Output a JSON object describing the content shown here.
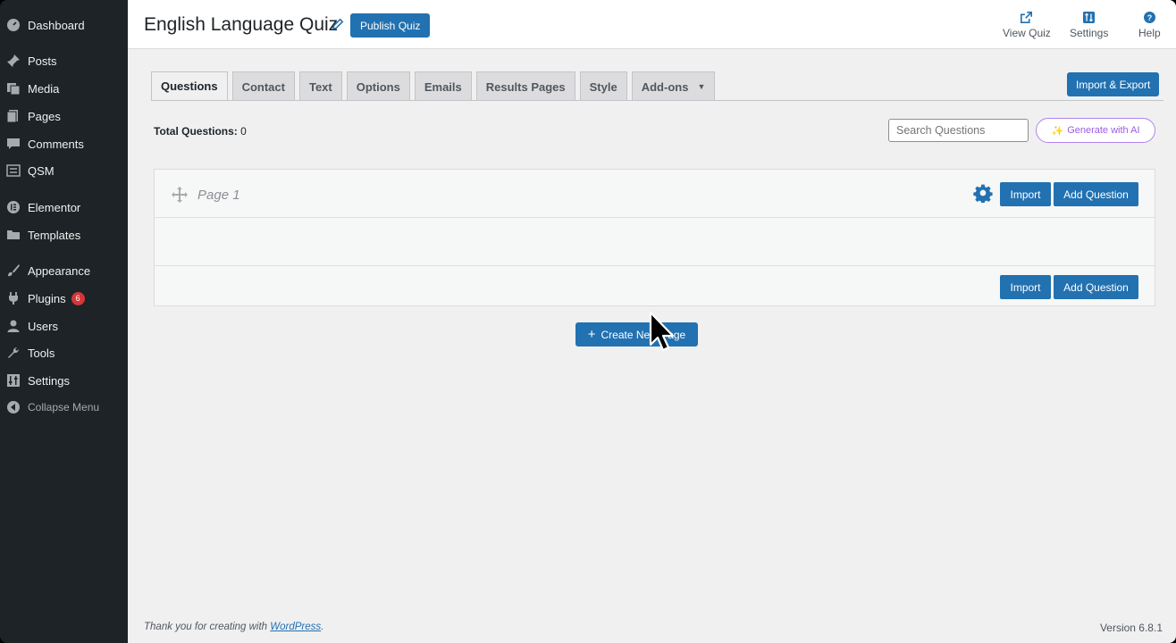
{
  "sidebar": {
    "items": [
      {
        "label": "Dashboard",
        "icon": "dashboard-icon"
      },
      {
        "label": "Posts",
        "icon": "pin-icon"
      },
      {
        "label": "Media",
        "icon": "media-icon"
      },
      {
        "label": "Pages",
        "icon": "pages-icon"
      },
      {
        "label": "Comments",
        "icon": "comment-icon"
      },
      {
        "label": "QSM",
        "icon": "qsm-icon"
      },
      {
        "label": "Elementor",
        "icon": "elementor-icon"
      },
      {
        "label": "Templates",
        "icon": "folder-icon"
      },
      {
        "label": "Appearance",
        "icon": "brush-icon"
      },
      {
        "label": "Plugins",
        "icon": "plugin-icon",
        "badge": "6"
      },
      {
        "label": "Users",
        "icon": "user-icon"
      },
      {
        "label": "Tools",
        "icon": "wrench-icon"
      },
      {
        "label": "Settings",
        "icon": "settings-sliders-icon"
      },
      {
        "label": "Collapse Menu",
        "icon": "collapse-icon"
      }
    ]
  },
  "header": {
    "title": "English Language Quiz",
    "publish_label": "Publish Quiz",
    "actions": [
      {
        "label": "View Quiz",
        "icon": "external-link-icon"
      },
      {
        "label": "Settings",
        "icon": "sliders-icon"
      },
      {
        "label": "Help",
        "icon": "help-icon"
      }
    ]
  },
  "tabs": [
    "Questions",
    "Contact",
    "Text",
    "Options",
    "Emails",
    "Results Pages",
    "Style",
    "Add-ons"
  ],
  "import_export_label": "Import & Export",
  "total_questions": {
    "label": "Total Questions:",
    "value": "0"
  },
  "search": {
    "placeholder": "Search Questions"
  },
  "generate_ai_label": "Generate with AI",
  "page": {
    "label": "Page 1",
    "import_label": "Import",
    "add_question_label": "Add Question"
  },
  "create_page_label": "Create New Page",
  "footer": {
    "prefix": "Thank you for creating with ",
    "link": "WordPress",
    "suffix": ".",
    "version": "Version 6.8.1"
  },
  "colors": {
    "accent": "#2271b1",
    "sidebar": "#1d2327",
    "ai": "#9b5de5"
  }
}
